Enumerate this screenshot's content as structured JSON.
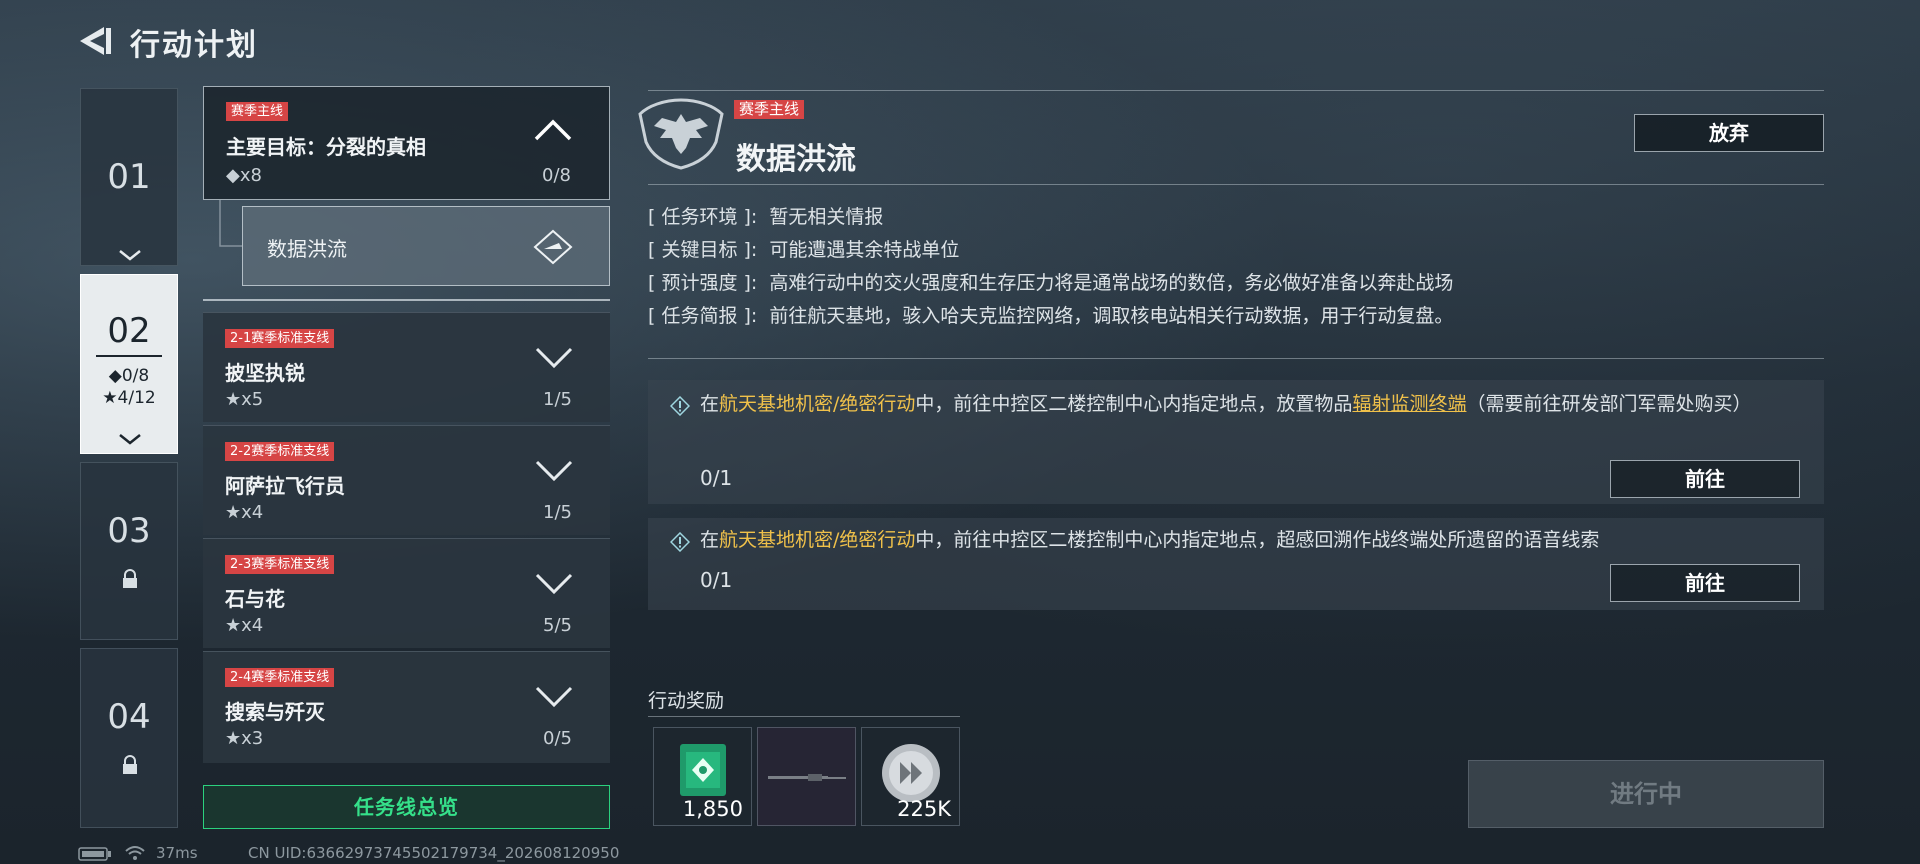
{
  "header": {
    "title": "行动计划",
    "back_icon": "back-arrow-icon"
  },
  "chapters": [
    {
      "num": "01",
      "locked": false
    },
    {
      "num": "02",
      "active": true,
      "diamond": "◆0/8",
      "star": "★4/12"
    },
    {
      "num": "03",
      "locked": true
    },
    {
      "num": "04",
      "locked": true
    }
  ],
  "missions": {
    "main": {
      "tag": "赛季主线",
      "title": "主要目标：分裂的真相",
      "count": "◆x8",
      "progress": "0/8",
      "sub": "数据洪流"
    },
    "list": [
      {
        "tag": "2-1赛季标准支线",
        "title": "披坚执锐",
        "count": "★x5",
        "progress": "1/5"
      },
      {
        "tag": "2-2赛季标准支线",
        "title": "阿萨拉飞行员",
        "count": "★x4",
        "progress": "1/5"
      },
      {
        "tag": "2-3赛季标准支线",
        "title": "石与花",
        "count": "★x4",
        "progress": "5/5"
      },
      {
        "tag": "2-4赛季标准支线",
        "title": "搜索与歼灭",
        "count": "★x3",
        "progress": "0/5"
      }
    ],
    "overview": "任务线总览"
  },
  "detail": {
    "tag": "赛季主线",
    "title": "数据洪流",
    "abandon": "放弃",
    "lines": [
      {
        "label": "[ 任务环境 ]:",
        "value": "暂无相关情报"
      },
      {
        "label": "[ 关键目标 ]:",
        "value": "可能遭遇其余特战单位"
      },
      {
        "label": "[ 预计强度 ]:",
        "value": "高难行动中的交火强度和生存压力将是通常战场的数倍，务必做好准备以奔赴战场"
      },
      {
        "label": "[ 任务简报 ]:",
        "value": "前往航天基地，骇入哈夫克监控网络，调取核电站相关行动数据，用于行动复盘。"
      }
    ],
    "objectives": [
      {
        "pre": "在",
        "loc": "航天基地机密/绝密行动",
        "mid": "中，前往中控区二楼控制中心内指定地点，放置物品",
        "item": "辐射监测终端",
        "post": "（需要前往研发部门军需处购买）",
        "progress": "0/1",
        "button": "前往"
      },
      {
        "pre": "在",
        "loc": "航天基地机密/绝密行动",
        "mid": "中，前往中控区二楼控制中心内指定地点，超感回溯作战终端处所遗留的语音线索",
        "progress": "0/1",
        "button": "前往"
      }
    ],
    "rewards_label": "行动奖励",
    "rewards": [
      {
        "icon": "green-crate-icon",
        "qty": "1,850"
      },
      {
        "icon": "rifle-icon",
        "qty": ""
      },
      {
        "icon": "silver-coin-icon",
        "qty": "225K"
      }
    ],
    "status_button": "进行中"
  },
  "statusbar": {
    "ping": "37ms",
    "uid": "CN UID:6366297374550217973​4_202608120950"
  },
  "colors": {
    "accent_green": "#35e08a",
    "tag_red": "#d64545",
    "highlight": "#f0c14a"
  }
}
